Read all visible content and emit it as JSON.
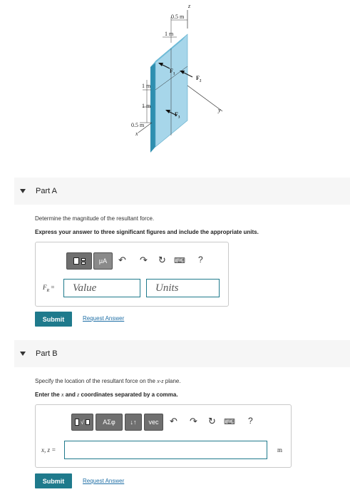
{
  "figure": {
    "axis_z": "z",
    "axis_y": "y",
    "axis_x": "x",
    "dim_top": "0.5 m",
    "dim_width": "1 m",
    "dim_left_1": "1 m",
    "dim_left_2": "1 m",
    "dim_bottom": "0.5 m",
    "force_1": "F",
    "force_1_sub": "1",
    "force_2": "F",
    "force_2_sub": "2",
    "force_3": "F",
    "force_3_sub": "3",
    "plate_color": "#a7d6ea",
    "plate_edge_color": "#2f8fb0"
  },
  "part_a": {
    "title": "Part A",
    "question": "Determine the magnitude of the resultant force.",
    "instruction": "Express your answer to three significant figures and include the appropriate units.",
    "toolbar": {
      "templates_icon": "templates-icon",
      "units_label": "μA",
      "undo_icon": "undo-icon",
      "redo_icon": "redo-icon",
      "reset_icon": "reset-icon",
      "keyboard_icon": "keyboard-icon",
      "help_label": "?"
    },
    "var_label": "F",
    "var_sub": "R",
    "var_eq": " =",
    "value_placeholder": "Value",
    "units_placeholder": "Units",
    "submit": "Submit",
    "request": "Request Answer"
  },
  "part_b": {
    "title": "Part B",
    "question_pre": "Specify the location of the resultant force on the ",
    "question_var": "x-z",
    "question_post": " plane.",
    "instruction_pre": "Enter the ",
    "instruction_var1": "x",
    "instruction_mid": " and ",
    "instruction_var2": "z",
    "instruction_post": " coordinates separated by a comma.",
    "toolbar": {
      "templates_icon": "templates-icon",
      "greek_label": "ΑΣφ",
      "arrows_label": "↓↑",
      "vec_label": "vec",
      "undo_icon": "undo-icon",
      "redo_icon": "redo-icon",
      "reset_icon": "reset-icon",
      "keyboard_icon": "keyboard-icon",
      "help_label": "?"
    },
    "var_label": "x, z =",
    "unit_suffix": "m",
    "submit": "Submit",
    "request": "Request Answer"
  }
}
